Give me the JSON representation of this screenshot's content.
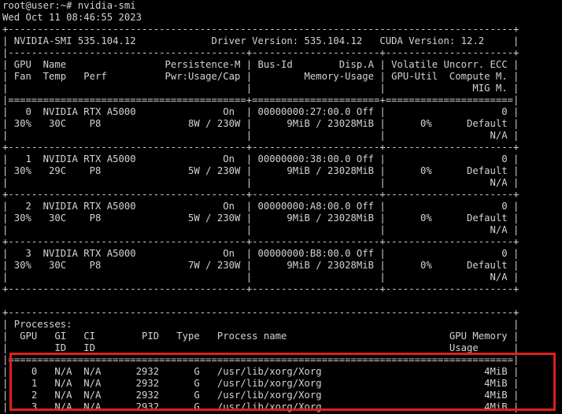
{
  "terminal": {
    "lines": [
      "root@user:~# nvidia-smi",
      "Wed Oct 11 08:46:55 2023",
      "+---------------------------------------------------------------------------------------+",
      "| NVIDIA-SMI 535.104.12             Driver Version: 535.104.12   CUDA Version: 12.2     |",
      "|-----------------------------------------+----------------------+----------------------+",
      "| GPU  Name                 Persistence-M | Bus-Id        Disp.A | Volatile Uncorr. ECC |",
      "| Fan  Temp   Perf          Pwr:Usage/Cap |         Memory-Usage | GPU-Util  Compute M. |",
      "|                                         |                      |               MIG M. |",
      "|=========================================+======================+======================|",
      "|   0  NVIDIA RTX A5000               On  | 00000000:27:00.0 Off |                    0 |",
      "| 30%   30C    P8               8W / 230W |      9MiB / 23028MiB |      0%      Default |",
      "|                                         |                      |                  N/A |",
      "+-----------------------------------------+----------------------+----------------------+",
      "|   1  NVIDIA RTX A5000               On  | 00000000:38:00.0 Off |                    0 |",
      "| 30%   29C    P8               5W / 230W |      9MiB / 23028MiB |      0%      Default |",
      "|                                         |                      |                  N/A |",
      "+-----------------------------------------+----------------------+----------------------+",
      "|   2  NVIDIA RTX A5000               On  | 00000000:A8:00.0 Off |                    0 |",
      "| 30%   30C    P8               5W / 230W |      9MiB / 23028MiB |      0%      Default |",
      "|                                         |                      |                  N/A |",
      "+-----------------------------------------+----------------------+----------------------+",
      "|   3  NVIDIA RTX A5000               On  | 00000000:B8:00.0 Off |                    0 |",
      "| 30%   30C    P8               7W / 230W |      9MiB / 23028MiB |      0%      Default |",
      "|                                         |                      |                  N/A |",
      "+-----------------------------------------+----------------------+----------------------+",
      "",
      "+---------------------------------------------------------------------------------------+",
      "| Processes:                                                                            |",
      "|  GPU   GI   CI        PID   Type   Process name                            GPU Memory |",
      "|        ID   ID                                                             Usage      |",
      "|=======================================================================================|",
      "|    0   N/A  N/A      2932      G   /usr/lib/xorg/Xorg                            4MiB |",
      "|    1   N/A  N/A      2932      G   /usr/lib/xorg/Xorg                            4MiB |",
      "|    2   N/A  N/A      2932      G   /usr/lib/xorg/Xorg                            4MiB |",
      "|    3   N/A  N/A      2932      G   /usr/lib/xorg/Xorg                            4MiB |"
    ]
  },
  "colors": {
    "background": "#000000",
    "text": "#d3d3d3",
    "highlight_border": "#e0201b"
  }
}
